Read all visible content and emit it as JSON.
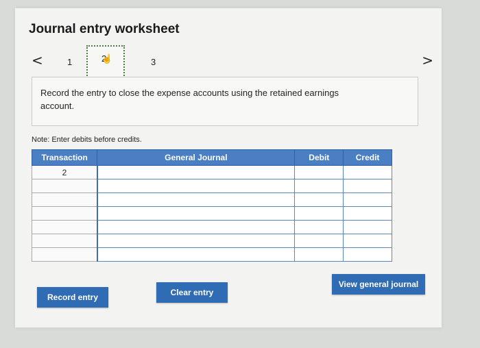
{
  "title": "Journal entry worksheet",
  "nav": {
    "prev_label": "<",
    "next_label": ">",
    "pages": [
      "1",
      "2",
      "3"
    ],
    "current_page": "2"
  },
  "instruction": "Record the entry to close the expense accounts using the retained earnings account.",
  "note": "Note: Enter debits before credits.",
  "table": {
    "headers": {
      "transaction": "Transaction",
      "journal": "General Journal",
      "debit": "Debit",
      "credit": "Credit"
    },
    "rows": [
      {
        "transaction": "2",
        "account": "",
        "debit": "",
        "credit": ""
      },
      {
        "transaction": "",
        "account": "",
        "debit": "",
        "credit": ""
      },
      {
        "transaction": "",
        "account": "",
        "debit": "",
        "credit": ""
      },
      {
        "transaction": "",
        "account": "",
        "debit": "",
        "credit": ""
      },
      {
        "transaction": "",
        "account": "",
        "debit": "",
        "credit": ""
      },
      {
        "transaction": "",
        "account": "",
        "debit": "",
        "credit": ""
      },
      {
        "transaction": "",
        "account": "",
        "debit": "",
        "credit": ""
      }
    ]
  },
  "buttons": {
    "record": "Record entry",
    "clear": "Clear entry",
    "view": "View general journal"
  },
  "colors": {
    "accent": "#2f6cb4",
    "header": "#4a7fc3"
  }
}
